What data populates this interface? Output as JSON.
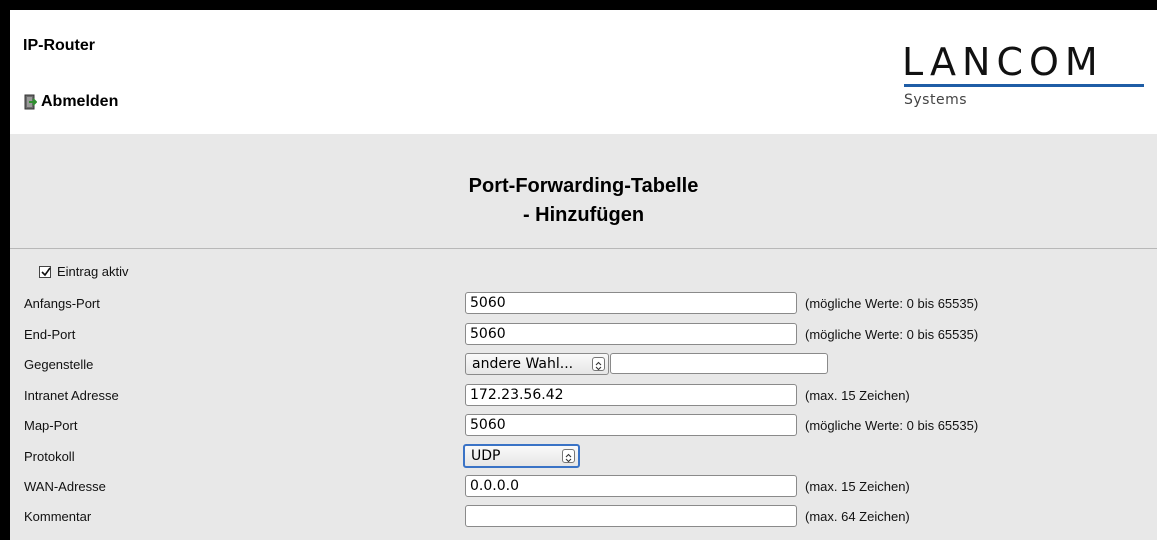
{
  "header": {
    "app_title": "IP-Router",
    "logout_label": "Abmelden",
    "logo_text": "LANCOM",
    "logo_subtext": "Systems",
    "logo_accent": "#1f5da6"
  },
  "page": {
    "title_line1": "Port-Forwarding-Tabelle",
    "title_line2": "- Hinzufügen"
  },
  "form": {
    "active": {
      "label": "Eintrag aktiv",
      "checked": true
    },
    "start_port": {
      "label": "Anfangs-Port",
      "value": "5060",
      "hint": "(mögliche Werte: 0 bis 65535)"
    },
    "end_port": {
      "label": "End-Port",
      "value": "5060",
      "hint": "(mögliche Werte: 0 bis 65535)"
    },
    "remote": {
      "label": "Gegenstelle",
      "selected": "andere Wahl...",
      "value": ""
    },
    "intranet": {
      "label": "Intranet Adresse",
      "value": "172.23.56.42",
      "hint": "(max. 15 Zeichen)"
    },
    "map_port": {
      "label": "Map-Port",
      "value": "5060",
      "hint": "(mögliche Werte: 0 bis 65535)"
    },
    "protocol": {
      "label": "Protokoll",
      "selected": "UDP"
    },
    "wan": {
      "label": "WAN-Adresse",
      "value": "0.0.0.0",
      "hint": "(max. 15 Zeichen)"
    },
    "comment": {
      "label": "Kommentar",
      "value": "",
      "hint": "(max. 64 Zeichen)"
    }
  }
}
